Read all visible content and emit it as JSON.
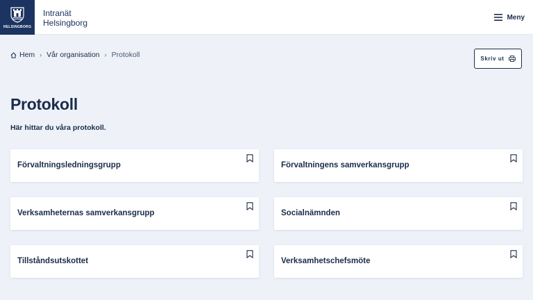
{
  "header": {
    "logo_text": "HELSINGBORG",
    "site_name_line1": "Intranät",
    "site_name_line2": "Helsingborg",
    "menu_label": "Meny"
  },
  "breadcrumb": {
    "items": [
      "Hem",
      "Vår organisation",
      "Protokoll"
    ]
  },
  "actions": {
    "print_label": "Skriv ut"
  },
  "page": {
    "title": "Protokoll",
    "intro": "Här hittar du våra protokoll."
  },
  "cards": [
    {
      "title": "Förvaltningsledningsgrupp"
    },
    {
      "title": "Förvaltningens samverkansgrupp"
    },
    {
      "title": "Verksamheternas samverkansgrupp"
    },
    {
      "title": "Socialnämnden"
    },
    {
      "title": "Tillståndsutskottet"
    },
    {
      "title": "Verksamhetschefsmöte"
    }
  ],
  "colors": {
    "brand": "#1c3461",
    "text": "#1b2c4a",
    "background": "#eef2f8",
    "card": "#ffffff"
  },
  "icons": {
    "menu": "hamburger-icon",
    "home": "home-icon",
    "separator": "chevron-right-icon",
    "print": "printer-icon",
    "bookmark": "bookmark-icon"
  }
}
